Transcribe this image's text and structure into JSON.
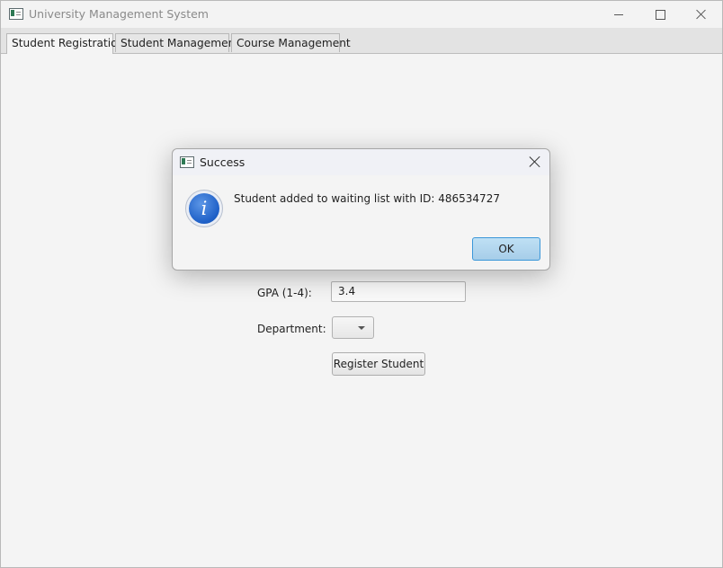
{
  "window": {
    "title": "University Management System"
  },
  "tabs": [
    {
      "label": "Student Registration"
    },
    {
      "label": "Student Management"
    },
    {
      "label": "Course Management"
    }
  ],
  "form": {
    "gpa_label": "GPA (1-4):",
    "gpa_value": "3.4",
    "department_label": "Department:",
    "department_value": "",
    "register_button": "Register Student"
  },
  "dialog": {
    "title": "Success",
    "message": "Student added to waiting list with ID: 486534727",
    "ok_label": "OK",
    "icon": "info-icon",
    "info_glyph": "i"
  }
}
